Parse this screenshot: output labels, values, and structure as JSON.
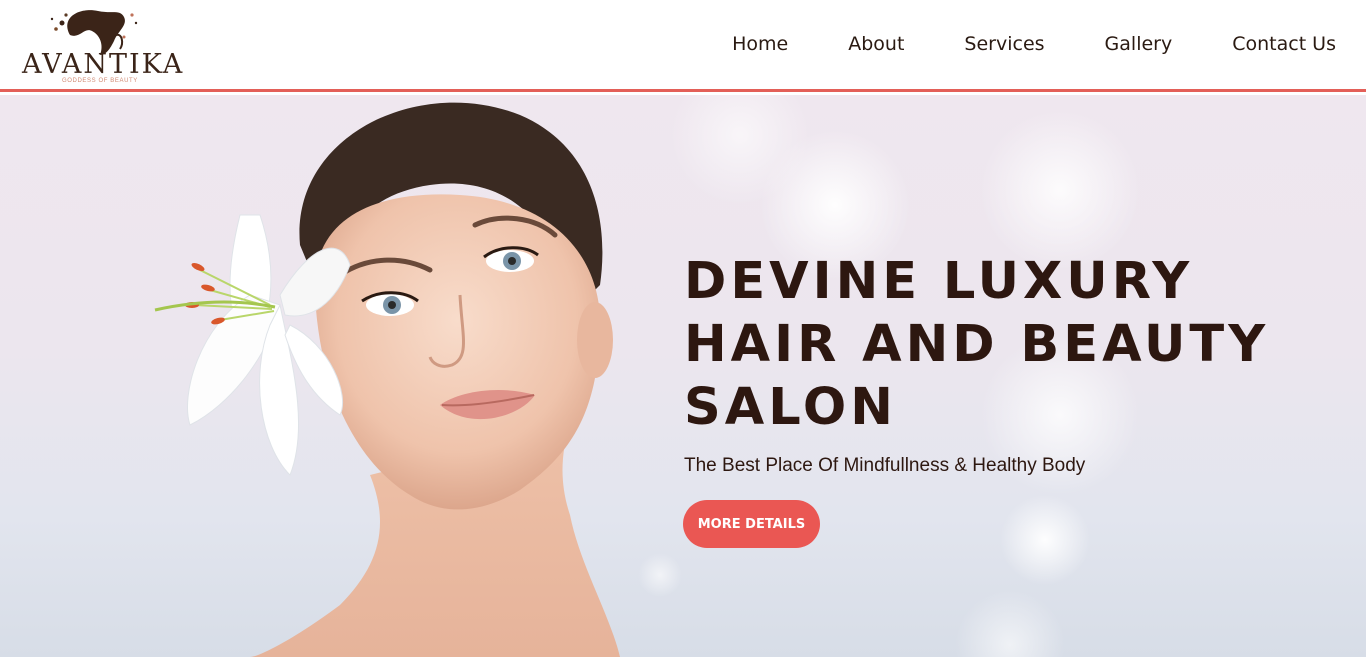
{
  "brand": {
    "name": "AVANTIKA",
    "tagline": "GODDESS OF BEAUTY",
    "accent_color": "#e35f58",
    "text_color": "#2d1710"
  },
  "nav": {
    "items": [
      {
        "label": "Home"
      },
      {
        "label": "About"
      },
      {
        "label": "Services"
      },
      {
        "label": "Gallery"
      },
      {
        "label": "Contact Us"
      }
    ]
  },
  "hero": {
    "headline": "DEVINE LUXURY HAIR AND BEAUTY SALON",
    "subtitle": "The Best Place Of Mindfullness & Healthy Body",
    "cta_label": "MORE DETAILS",
    "cta_color": "#ea5753",
    "image_description_icon": "woman-with-lily-portrait"
  }
}
